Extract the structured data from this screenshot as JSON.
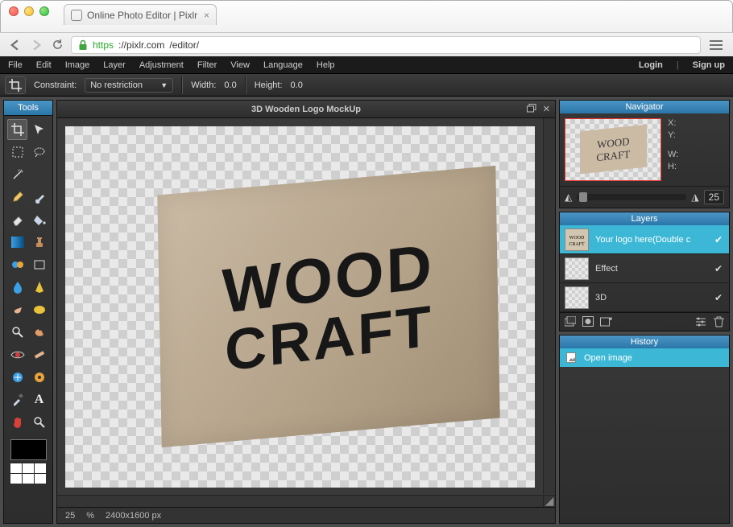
{
  "browser": {
    "tab_title": "Online Photo Editor | Pixlr",
    "url_scheme": "https",
    "url_host": "://pixlr.com",
    "url_path": "/editor/"
  },
  "menubar": {
    "items": [
      "File",
      "Edit",
      "Image",
      "Layer",
      "Adjustment",
      "Filter",
      "View",
      "Language",
      "Help"
    ],
    "login": "Login",
    "signup": "Sign up"
  },
  "options": {
    "constraint_label": "Constraint:",
    "constraint_value": "No restriction",
    "width_label": "Width:",
    "width_value": "0.0",
    "height_label": "Height:",
    "height_value": "0.0"
  },
  "tools_title": "Tools",
  "document": {
    "title": "3D Wooden Logo MockUp",
    "zoom_pct": "25",
    "pct_sym": "%",
    "dimensions": "2400x1600 px",
    "art_line1": "WOOD",
    "art_line2": "CRAFT"
  },
  "navigator": {
    "title": "Navigator",
    "coords": {
      "x": "X:",
      "y": "Y:",
      "w": "W:",
      "h": "H:"
    },
    "zoom_value": "25",
    "thumb_l1": "WOOD",
    "thumb_l2": "CRAFT"
  },
  "layers": {
    "title": "Layers",
    "items": [
      {
        "name": "Your logo here(Double c",
        "visible": true,
        "active": true,
        "transparent": false
      },
      {
        "name": "Effect",
        "visible": true,
        "active": false,
        "transparent": true
      },
      {
        "name": "3D",
        "visible": true,
        "active": false,
        "transparent": true
      }
    ]
  },
  "history": {
    "title": "History",
    "items": [
      "Open image"
    ]
  }
}
